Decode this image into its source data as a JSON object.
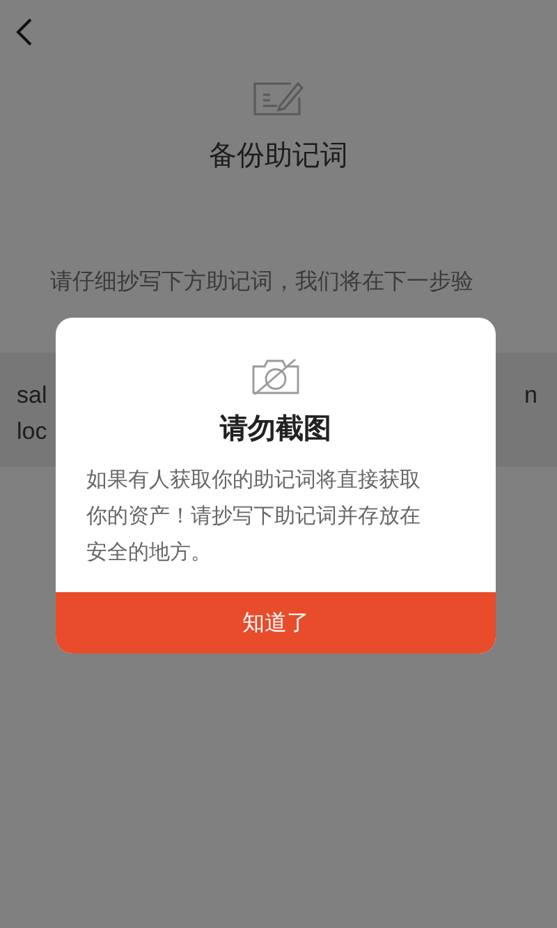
{
  "page": {
    "title": "备份助记词",
    "instruction": "请仔细抄写下方助记词，我们将在下一步验"
  },
  "mnemonic": {
    "rows": [
      {
        "left": "sal",
        "right": "n"
      },
      {
        "left": "loc",
        "right": ""
      }
    ]
  },
  "dialog": {
    "title": "请勿截图",
    "message": "如果有人获取你的助记词将直接获取你的资产！请抄写下助记词并存放在安全的地方。",
    "button": "知道了"
  }
}
